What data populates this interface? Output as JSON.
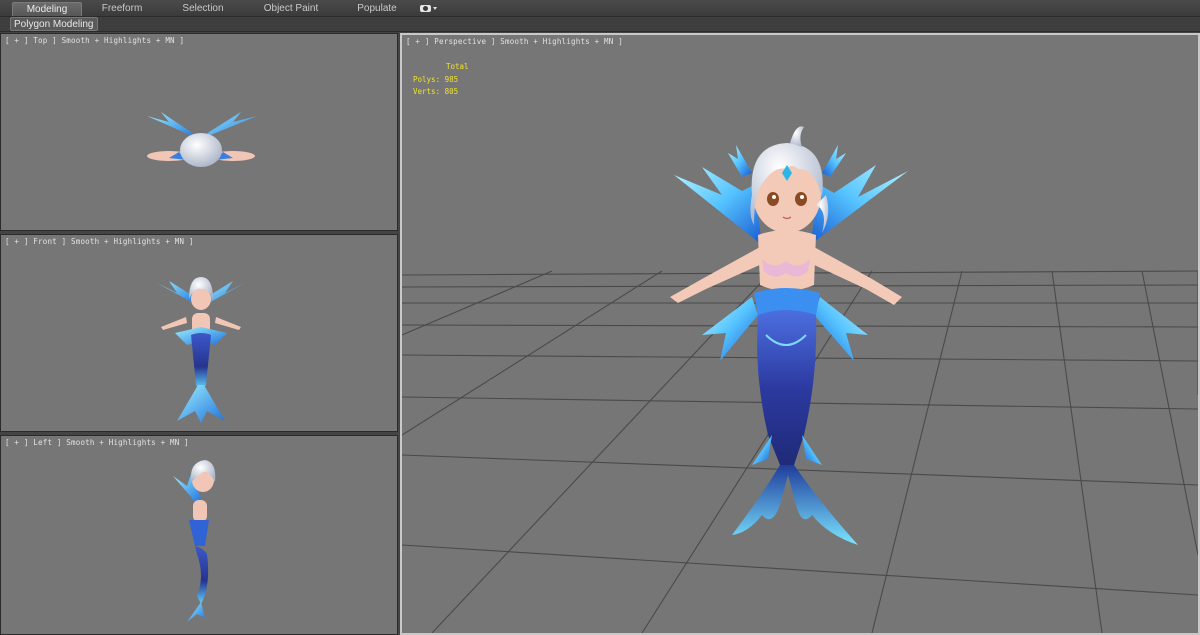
{
  "ribbon": {
    "tabs": [
      {
        "label": "Modeling",
        "active": true
      },
      {
        "label": "Freeform",
        "active": false
      },
      {
        "label": "Selection",
        "active": false
      },
      {
        "label": "Object Paint",
        "active": false
      },
      {
        "label": "Populate",
        "active": false
      }
    ],
    "extra_icon": "camera-icon",
    "panel_label": "Polygon Modeling"
  },
  "viewports": {
    "top": {
      "label": "[ + ] Top ] Smooth + Highlights + MN ]"
    },
    "front": {
      "label": "[ + ] Front ] Smooth + Highlights + MN ]"
    },
    "left": {
      "label": "[ + ] Left ] Smooth + Highlights + MN ]"
    },
    "perspective": {
      "label": "[ + ] Perspective ] Smooth + Highlights + MN ]",
      "stats": {
        "header": "Total",
        "polys_label": "Polys:",
        "polys": "985",
        "verts_label": "Verts:",
        "verts": "805"
      }
    }
  },
  "colors": {
    "viewport_bg": "#767676",
    "grid": "#555555",
    "stats_text": "#f0e22e",
    "fin_light": "#7fe2ff",
    "fin_dark": "#1e6fd9",
    "tail_dark": "#2b3a9c",
    "skin": "#f2c6b6",
    "hair": "#dfe4ee"
  }
}
